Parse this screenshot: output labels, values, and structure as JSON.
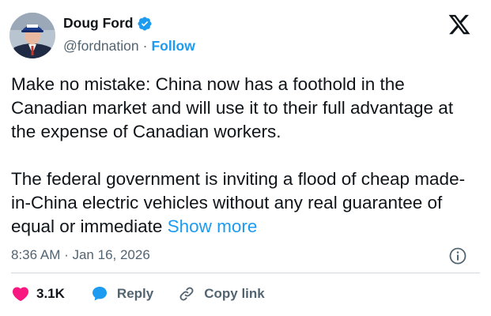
{
  "author": {
    "display_name": "Doug Ford",
    "handle": "@fordnation",
    "separator": "·",
    "follow_label": "Follow",
    "verified": true
  },
  "tweet": {
    "paragraph_1": "Make no mistake: China now has a foothold in the Canadian market and will use it to their full advantage at the expense of Canadian workers.",
    "paragraph_2": "The federal government is inviting a flood of cheap made-in-China electric vehicles without any real guarantee of equal or immediate",
    "show_more_label": "Show more",
    "timestamp": "8:36 AM · Jan 16, 2026"
  },
  "actions": {
    "like_count": "3.1K",
    "reply_label": "Reply",
    "copy_link_label": "Copy link"
  },
  "colors": {
    "accent": "#1d9bf0",
    "like": "#f91880",
    "text": "#0f1419",
    "secondary": "#536471"
  },
  "icons": {
    "verified": "verified-badge-icon",
    "brand": "x-logo-icon",
    "info": "info-icon",
    "like": "heart-icon",
    "reply": "speech-bubble-icon",
    "copy": "link-icon"
  }
}
